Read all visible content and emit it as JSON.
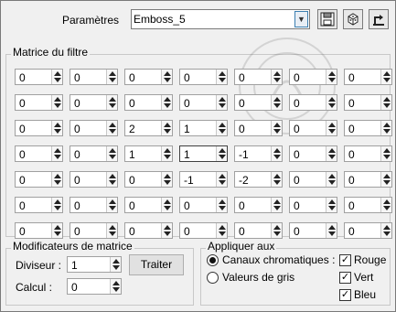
{
  "header": {
    "params_label": "Paramètres",
    "preset_value": "Emboss_5"
  },
  "matrix": {
    "title": "Matrice du filtre",
    "rows": [
      [
        "0",
        "0",
        "0",
        "0",
        "0",
        "0",
        "0"
      ],
      [
        "0",
        "0",
        "0",
        "0",
        "0",
        "0",
        "0"
      ],
      [
        "0",
        "0",
        "2",
        "1",
        "0",
        "0",
        "0"
      ],
      [
        "0",
        "0",
        "1",
        "1",
        "-1",
        "0",
        "0"
      ],
      [
        "0",
        "0",
        "0",
        "-1",
        "-2",
        "0",
        "0"
      ],
      [
        "0",
        "0",
        "0",
        "0",
        "0",
        "0",
        "0"
      ],
      [
        "0",
        "0",
        "0",
        "0",
        "0",
        "0",
        "0"
      ]
    ]
  },
  "modifiers": {
    "title": "Modificateurs de matrice",
    "divisor_label": "Diviseur :",
    "divisor_value": "1",
    "bias_label": "Calcul :",
    "bias_value": "0",
    "apply_button": "Traiter"
  },
  "apply_to": {
    "title": "Appliquer aux",
    "color_channels_label": "Canaux chromatiques :",
    "grayscale_label": "Valeurs de gris",
    "red_label": "Rouge",
    "green_label": "Vert",
    "blue_label": "Bleu",
    "color_channels_selected": true,
    "red_checked": true,
    "green_checked": true,
    "blue_checked": true
  },
  "icons": [
    "save-icon",
    "dice-icon",
    "reset-icon"
  ]
}
